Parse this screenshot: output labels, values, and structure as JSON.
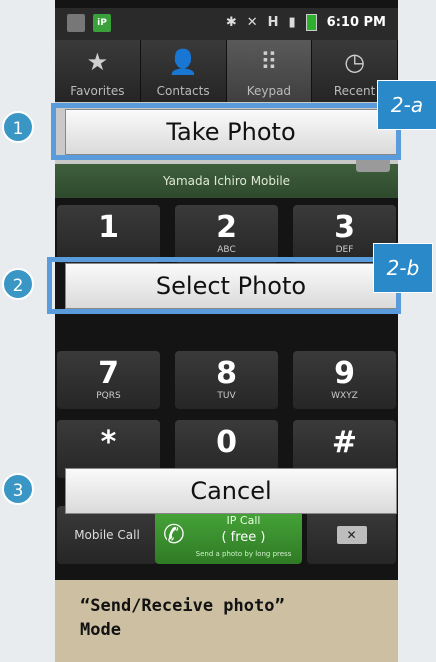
{
  "status_bar": {
    "app_icon_text": "iP",
    "time": "6:10 PM",
    "signal": "H",
    "icons": [
      "camera-icon",
      "app-icon",
      "bluetooth-icon",
      "mute-icon",
      "signal-icon",
      "battery-icon"
    ]
  },
  "tabs": [
    {
      "label": "Favorites",
      "icon": "star-icon",
      "glyph": "★"
    },
    {
      "label": "Contacts",
      "icon": "person-icon",
      "glyph": "👤"
    },
    {
      "label": "Keypad",
      "icon": "keypad-icon",
      "glyph": "⠿"
    },
    {
      "label": "Recent",
      "icon": "clock-icon",
      "glyph": "◷"
    }
  ],
  "contact": {
    "name_line": "Yamada Ichiro  Mobile"
  },
  "keys": [
    {
      "digit": "1",
      "sub": ""
    },
    {
      "digit": "2",
      "sub": "ABC"
    },
    {
      "digit": "3",
      "sub": "DEF"
    },
    {
      "digit": "7",
      "sub": "PQRS"
    },
    {
      "digit": "8",
      "sub": "TUV"
    },
    {
      "digit": "9",
      "sub": "WXYZ"
    },
    {
      "digit": "*",
      "sub": ""
    },
    {
      "digit": "0",
      "sub": ""
    },
    {
      "digit": "#",
      "sub": ""
    }
  ],
  "call_row": {
    "mobile_call": "Mobile Call",
    "ip_call_title": "IP Call",
    "ip_call_price": "( free )",
    "ip_call_hint": "Send a photo by long press"
  },
  "popup": {
    "take_photo": "Take Photo",
    "select_photo": "Select Photo",
    "cancel": "Cancel"
  },
  "annotations": {
    "step1": "1",
    "step2": "2",
    "step3": "3",
    "tag_2a": "2-a",
    "tag_2b": "2-b"
  },
  "caption": {
    "line1": "“Send/Receive photo”",
    "line2": "Mode"
  },
  "colors": {
    "highlight": "#5a9bdc",
    "step_badge": "#3a97c5",
    "tag": "#2a89c8",
    "caption_bg": "#cdc0a2",
    "ip_call_green": "#3c8f30"
  }
}
